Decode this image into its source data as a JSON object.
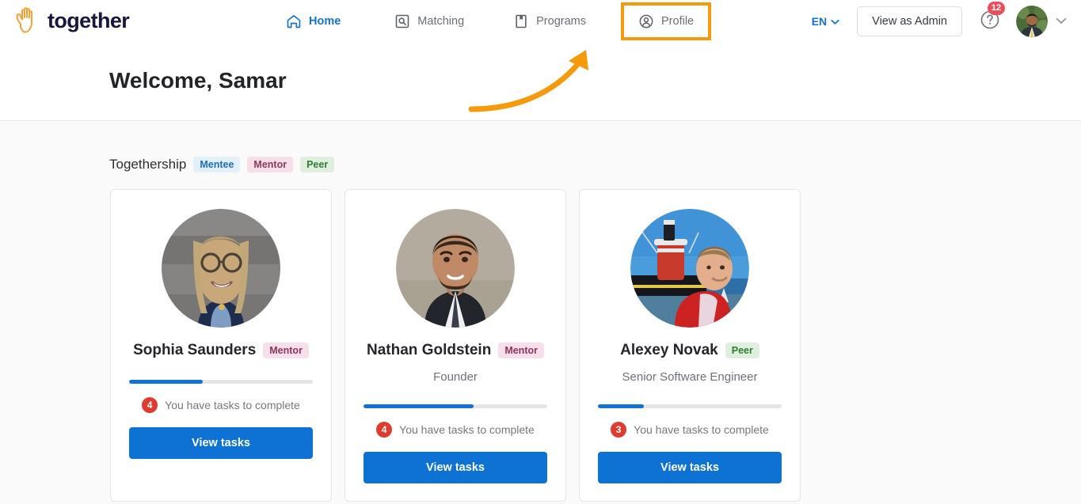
{
  "brand": {
    "name": "together",
    "logo_icon": "hand-icon",
    "logo_color": "#f5a033",
    "text_color": "#16163f"
  },
  "nav": {
    "items": [
      {
        "label": "Home",
        "icon": "home-icon",
        "active": true
      },
      {
        "label": "Matching",
        "icon": "search-square-icon",
        "active": false
      },
      {
        "label": "Programs",
        "icon": "bookmark-icon",
        "active": false
      },
      {
        "label": "Profile",
        "icon": "user-circle-icon",
        "active": false,
        "highlighted": true
      }
    ],
    "active_color": "#1273d4",
    "highlight_color": "#f59a0b"
  },
  "header_right": {
    "language": {
      "label": "EN",
      "icon": "chevron-down-icon",
      "color": "#1273d4"
    },
    "admin_button": {
      "label": "View as Admin"
    },
    "help": {
      "icon": "question-circle-icon",
      "badge_count": "12",
      "badge_color": "#e8505b"
    },
    "avatar": {
      "icon": "user-avatar",
      "alt": "Samar"
    },
    "caret": {
      "icon": "chevron-down-icon"
    }
  },
  "welcome": {
    "title": "Welcome, Samar"
  },
  "section": {
    "title": "Togethership",
    "legend": [
      {
        "label": "Mentee",
        "bg": "#e3effb",
        "fg": "#1b6fc4"
      },
      {
        "label": "Mentor",
        "bg": "#f6dfe9",
        "fg": "#8d3761"
      },
      {
        "label": "Peer",
        "bg": "#deefdd",
        "fg": "#2f7d32"
      }
    ]
  },
  "cards": [
    {
      "name": "Sophia Saunders",
      "badge": "Mentor",
      "badge_type": "mentor",
      "role": "",
      "progress_percent": 40,
      "task_count": "4",
      "task_text": "You have tasks to complete",
      "button_label": "View tasks",
      "avatar_alt": "Sophia Saunders"
    },
    {
      "name": "Nathan Goldstein",
      "badge": "Mentor",
      "badge_type": "mentor",
      "role": "Founder",
      "progress_percent": 60,
      "task_count": "4",
      "task_text": "You have tasks to complete",
      "button_label": "View tasks",
      "avatar_alt": "Nathan Goldstein"
    },
    {
      "name": "Alexey Novak",
      "badge": "Peer",
      "badge_type": "peer",
      "role": "Senior Software Engineer",
      "progress_percent": 25,
      "task_count": "3",
      "task_text": "You have tasks to complete",
      "button_label": "View tasks",
      "avatar_alt": "Alexey Novak"
    }
  ],
  "annotation": {
    "type": "curved-arrow",
    "color": "#f59a0b",
    "points_to": "Profile"
  }
}
